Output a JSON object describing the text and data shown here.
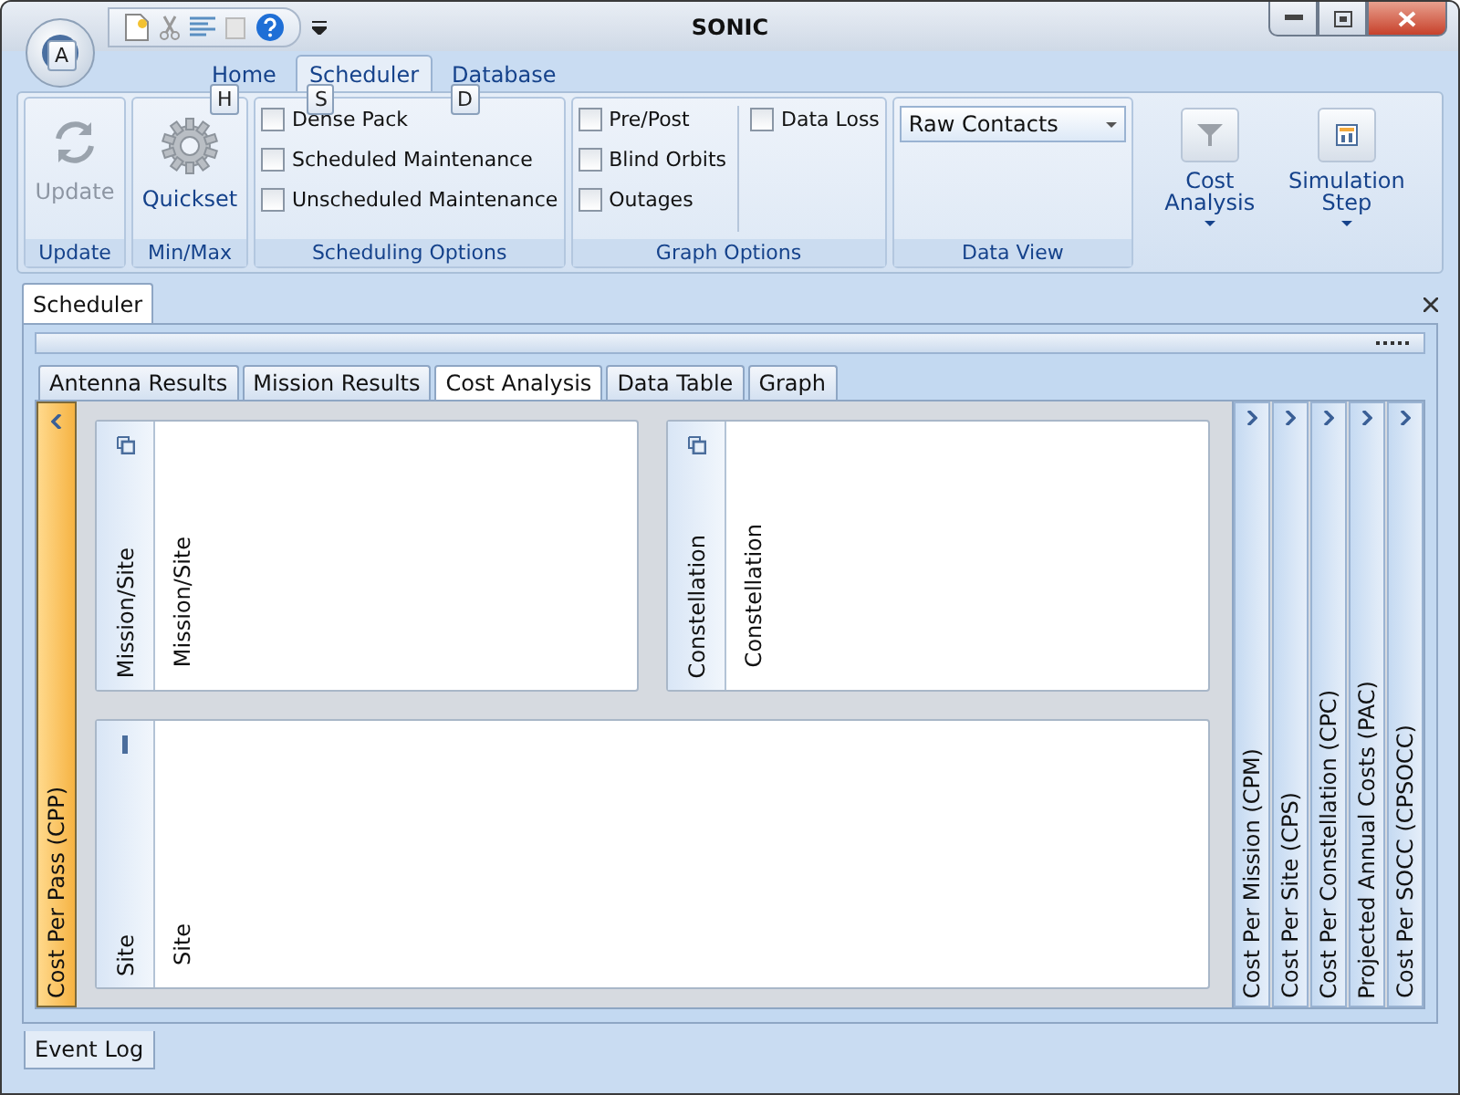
{
  "window": {
    "title": "SONIC"
  },
  "ribbon": {
    "app_keytip": "A",
    "tabs": [
      {
        "label": "Home",
        "keytip": "H",
        "selected": false
      },
      {
        "label": "Scheduler",
        "keytip": "S",
        "selected": true
      },
      {
        "label": "Database",
        "keytip": "D",
        "selected": false
      }
    ],
    "update_group": {
      "label": "Update",
      "button": {
        "label": "Update",
        "disabled": true
      }
    },
    "minmax_group": {
      "label": "Min/Max",
      "button": {
        "label": "Quickset",
        "disabled": false
      }
    },
    "scheduling_options": {
      "label": "Scheduling Options",
      "checkboxes": [
        {
          "label": "Dense Pack",
          "checked": false
        },
        {
          "label": "Scheduled Maintenance",
          "checked": false
        },
        {
          "label": "Unscheduled Maintenance",
          "checked": false
        }
      ]
    },
    "graph_options": {
      "label": "Graph Options",
      "columns": [
        [
          {
            "label": "Pre/Post",
            "checked": false
          },
          {
            "label": "Blind Orbits",
            "checked": false
          },
          {
            "label": "Outages",
            "checked": false
          }
        ],
        [
          {
            "label": "Data Loss",
            "checked": false
          }
        ]
      ]
    },
    "data_view": {
      "label": "Data View",
      "dropdown": {
        "value": "Raw Contacts"
      }
    },
    "cost_analysis_button": {
      "label": "Cost Analysis"
    },
    "simulation_step_button": {
      "label": "Simulation Step"
    }
  },
  "document_tabs": [
    {
      "label": "Scheduler",
      "selected": true
    }
  ],
  "view_tabs": [
    {
      "label": "Antenna Results",
      "selected": false
    },
    {
      "label": "Mission Results",
      "selected": false
    },
    {
      "label": "Cost Analysis",
      "selected": true
    },
    {
      "label": "Data Table",
      "selected": false
    },
    {
      "label": "Graph",
      "selected": false
    }
  ],
  "left_panel": {
    "label": "Cost Per Pass (CPP)"
  },
  "cards": [
    {
      "header": "Mission/Site",
      "body": "Mission/Site",
      "kind": "restore"
    },
    {
      "header": "Constellation",
      "body": "Constellation",
      "kind": "restore"
    },
    {
      "header": "Site",
      "body": "Site",
      "kind": "minimize"
    }
  ],
  "right_panels": [
    {
      "label": "Cost Per Mission (CPM)"
    },
    {
      "label": "Cost Per Site (CPS)"
    },
    {
      "label": "Cost Per Constellation (CPC)"
    },
    {
      "label": "Projected Annual Costs (PAC)"
    },
    {
      "label": "Cost Per SOCC (CPSOCC)"
    }
  ],
  "bottom_tabs": [
    {
      "label": "Event Log"
    }
  ]
}
